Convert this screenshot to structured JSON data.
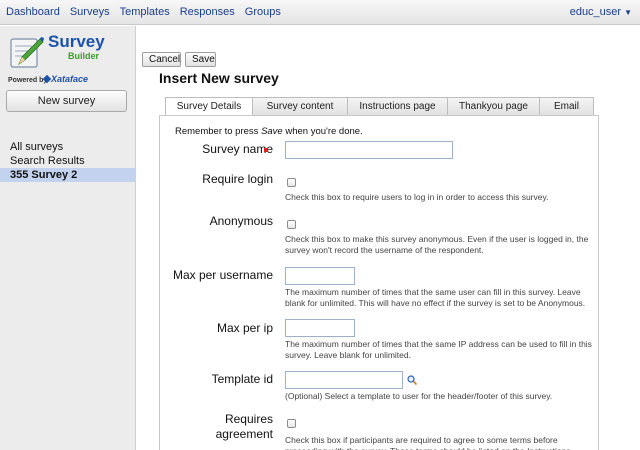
{
  "nav": {
    "items": [
      "Dashboard",
      "Surveys",
      "Templates",
      "Responses",
      "Groups"
    ],
    "user": "educ_user",
    "user_caret": "▼"
  },
  "sidebar": {
    "logo_line1": "Survey",
    "logo_line2": "Builder",
    "powered_by": "Powered by",
    "powered_brand": "Xataface",
    "new_survey_label": "New survey",
    "links": [
      {
        "label": "All surveys",
        "active": false
      },
      {
        "label": "Search Results",
        "active": false
      },
      {
        "label": "355 Survey 2",
        "active": true
      }
    ]
  },
  "toolbar": {
    "cancel_label": "Cancel",
    "save_label": "Save"
  },
  "page_title": "Insert New survey",
  "tabs": [
    {
      "label": "Survey Details",
      "active": true
    },
    {
      "label": "Survey content",
      "active": false
    },
    {
      "label": "Instructions page",
      "active": false
    },
    {
      "label": "Thankyou page",
      "active": false
    },
    {
      "label": "Email",
      "active": false
    }
  ],
  "form": {
    "reminder_pre": "Remember to press ",
    "reminder_em": "Save",
    "reminder_post": " when you're done.",
    "fields": {
      "survey_name": {
        "label": "Survey name",
        "value": "",
        "required": true
      },
      "require_login": {
        "label": "Require login",
        "checked": false,
        "help": "Check this box to require users to log in in order to access this survey."
      },
      "anonymous": {
        "label": "Anonymous",
        "checked": false,
        "help": "Check this box to make this survey anonymous. Even if the user is logged in, the survey won't record the username of the respondent."
      },
      "max_per_username": {
        "label": "Max per username",
        "value": "",
        "help": "The maximum number of times that the same user can fill in this survey. Leave blank for unlimited. This will have no effect if the survey is set to be Anonymous."
      },
      "max_per_ip": {
        "label": "Max per ip",
        "value": "",
        "help": "The maximum number of times that the same IP address can be used to fill in this survey. Leave blank for unlimited."
      },
      "template_id": {
        "label": "Template id",
        "value": "",
        "help": "(Optional) Select a template to user for the header/footer of this survey."
      },
      "requires_agreement": {
        "label_line1": "Requires",
        "label_line2": "agreement",
        "checked": false,
        "help": "Check this box if participants are required to agree to some terms before proceeding with the survey. These terms should be listed on the Instructions"
      }
    }
  },
  "colors": {
    "link": "#1a3e8c",
    "active_sidebar": "#c3d3ef",
    "required_marker": "#e02020",
    "logo_blue": "#1c52a8",
    "logo_green": "#3e9a2c"
  }
}
